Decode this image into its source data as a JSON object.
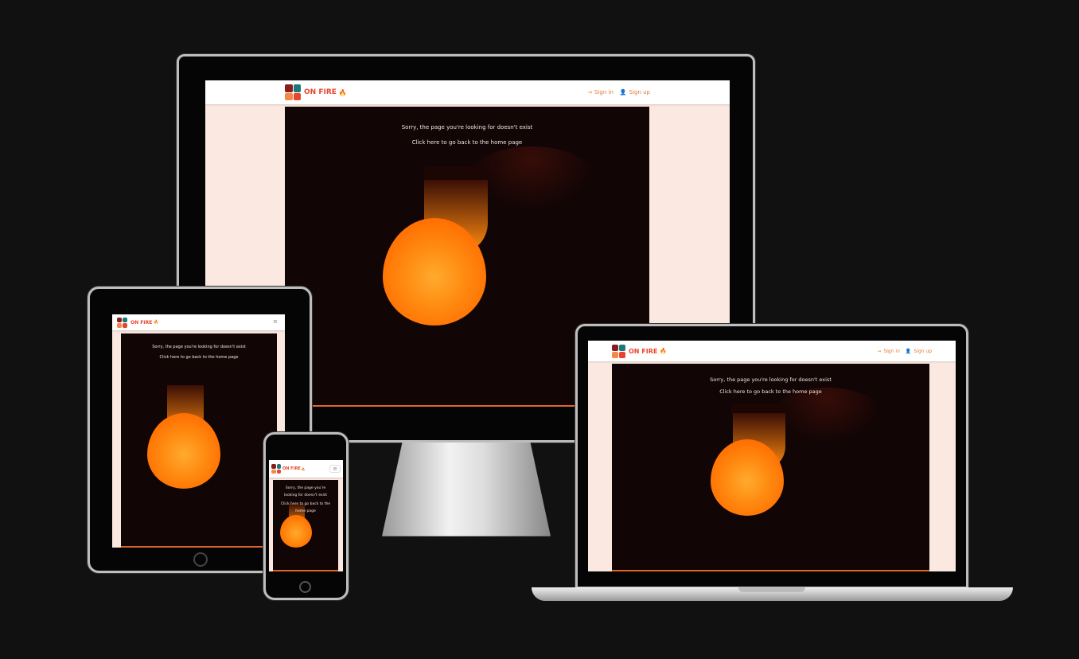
{
  "site": {
    "brand": "ON FIRE",
    "brand_emoji": "🔥",
    "logo_colors": [
      "#8a1c1c",
      "#1a7a7a",
      "#f4884a",
      "#e8452c"
    ],
    "accent": "#e8452c"
  },
  "nav": {
    "sign_in": "Sign in",
    "sign_up": "Sign up",
    "sign_in_icon": "sign-in-icon",
    "sign_up_icon": "user-plus-icon",
    "menu_icon": "hamburger-icon"
  },
  "page": {
    "error_message": "Sorry, the page you're looking for doesn't exist",
    "home_link": "Click here to go back to the home page"
  },
  "devices": [
    "desktop",
    "laptop",
    "tablet",
    "phone"
  ]
}
